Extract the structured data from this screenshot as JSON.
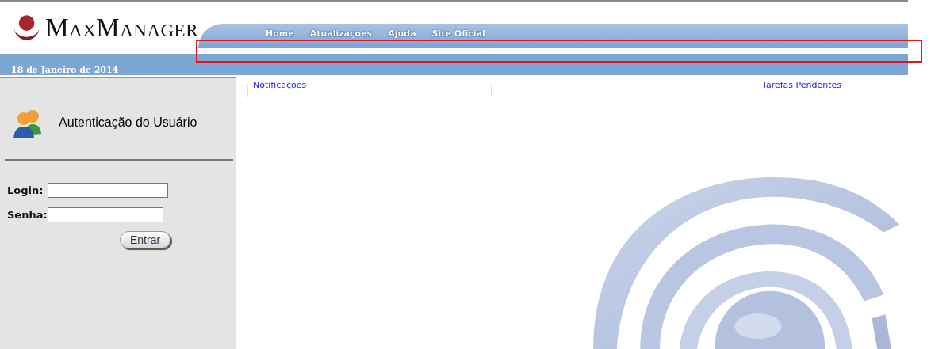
{
  "logo": {
    "text": "MaxManager"
  },
  "nav": [
    {
      "label": "Home"
    },
    {
      "label": "Atualizações"
    },
    {
      "label": "Ajuda"
    },
    {
      "label": "Site Oficial"
    }
  ],
  "date": "18 de Janeiro de 2014",
  "login_panel": {
    "title": "Autenticação do Usuário",
    "fields": [
      {
        "label": "Login:",
        "kind": "text"
      },
      {
        "label": "Senha:",
        "kind": "password"
      }
    ],
    "button": "Entrar"
  },
  "panels": [
    {
      "title": "Notificações"
    },
    {
      "title": "Tarefas Pendentes"
    }
  ]
}
